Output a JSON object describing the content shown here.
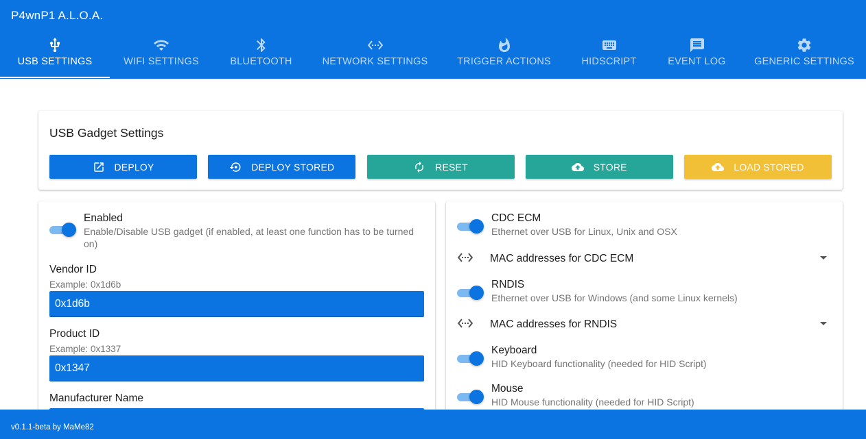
{
  "app": {
    "title": "P4wnP1 A.L.O.A."
  },
  "tabs": [
    {
      "label": "USB SETTINGS",
      "icon": "usb-icon"
    },
    {
      "label": "WIFI SETTINGS",
      "icon": "wifi-icon"
    },
    {
      "label": "BLUETOOTH",
      "icon": "bluetooth-icon"
    },
    {
      "label": "NETWORK SETTINGS",
      "icon": "settings-ethernet-icon"
    },
    {
      "label": "TRIGGER ACTIONS",
      "icon": "whatshot-icon"
    },
    {
      "label": "HIDSCRIPT",
      "icon": "keyboard-icon"
    },
    {
      "label": "EVENT LOG",
      "icon": "message-icon"
    },
    {
      "label": "GENERIC SETTINGS",
      "icon": "settings-icon"
    }
  ],
  "gadget": {
    "title": "USB Gadget Settings",
    "buttons": {
      "deploy": "DEPLOY",
      "deploy_stored": "DEPLOY STORED",
      "reset": "RESET",
      "store": "STORE",
      "load_stored": "LOAD STORED"
    }
  },
  "left": {
    "enabled": {
      "label": "Enabled",
      "desc": "Enable/Disable USB gadget (if enabled, at least one function has to be turned on)",
      "on": true
    },
    "vendor": {
      "label": "Vendor ID",
      "hint": "Example: 0x1d6b",
      "value": "0x1d6b"
    },
    "product": {
      "label": "Product ID",
      "hint": "Example: 0x1337",
      "value": "0x1347"
    },
    "manufacturer": {
      "label": "Manufacturer Name"
    }
  },
  "right": {
    "cdc_ecm": {
      "label": "CDC ECM",
      "desc": "Ethernet over USB for Linux, Unix and OSX",
      "on": true
    },
    "mac_cdc": {
      "label": "MAC addresses for CDC ECM"
    },
    "rndis": {
      "label": "RNDIS",
      "desc": "Ethernet over USB for Windows (and some Linux kernels)",
      "on": true
    },
    "mac_rndis": {
      "label": "MAC addresses for RNDIS"
    },
    "keyboard": {
      "label": "Keyboard",
      "desc": "HID Keyboard functionality (needed for HID Script)",
      "on": true
    },
    "mouse": {
      "label": "Mouse",
      "desc": "HID Mouse functionality (needed for HID Script)",
      "on": true
    }
  },
  "footer": {
    "text": "v0.1.1-beta by MaMe82"
  },
  "colors": {
    "primary": "#0b74e0",
    "teal": "#26a699",
    "yellow": "#f2c037"
  }
}
